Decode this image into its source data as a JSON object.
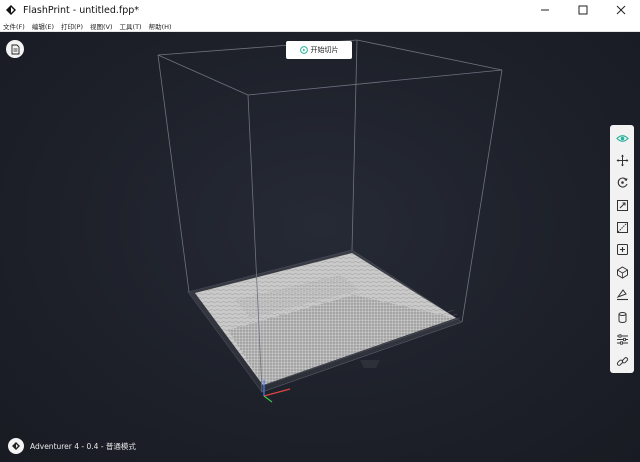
{
  "window": {
    "title": "FlashPrint - untitled.fpp*",
    "controls": [
      "minimize-icon",
      "maximize-icon",
      "close-icon"
    ]
  },
  "menu": [
    {
      "label": "文件(F)"
    },
    {
      "label": "编辑(E)"
    },
    {
      "label": "打印(P)"
    },
    {
      "label": "视图(V)"
    },
    {
      "label": "工具(T)"
    },
    {
      "label": "帮助(H)"
    }
  ],
  "viewport": {
    "slice_button": "开始切片",
    "accent_color": "#2bb39a"
  },
  "toolbar": {
    "tools": [
      {
        "icon": "eye-icon",
        "active": true
      },
      {
        "icon": "move-icon"
      },
      {
        "icon": "rotate-icon"
      },
      {
        "icon": "scale-icon"
      },
      {
        "icon": "cut-icon"
      },
      {
        "icon": "add-icon"
      },
      {
        "icon": "support-icon"
      },
      {
        "icon": "lay-flat-icon"
      },
      {
        "icon": "cylinder-icon"
      },
      {
        "icon": "settings-sliders-icon"
      },
      {
        "icon": "link-icon"
      }
    ]
  },
  "status": {
    "text": "Adventurer 4 - 0.4 - 普通模式"
  }
}
